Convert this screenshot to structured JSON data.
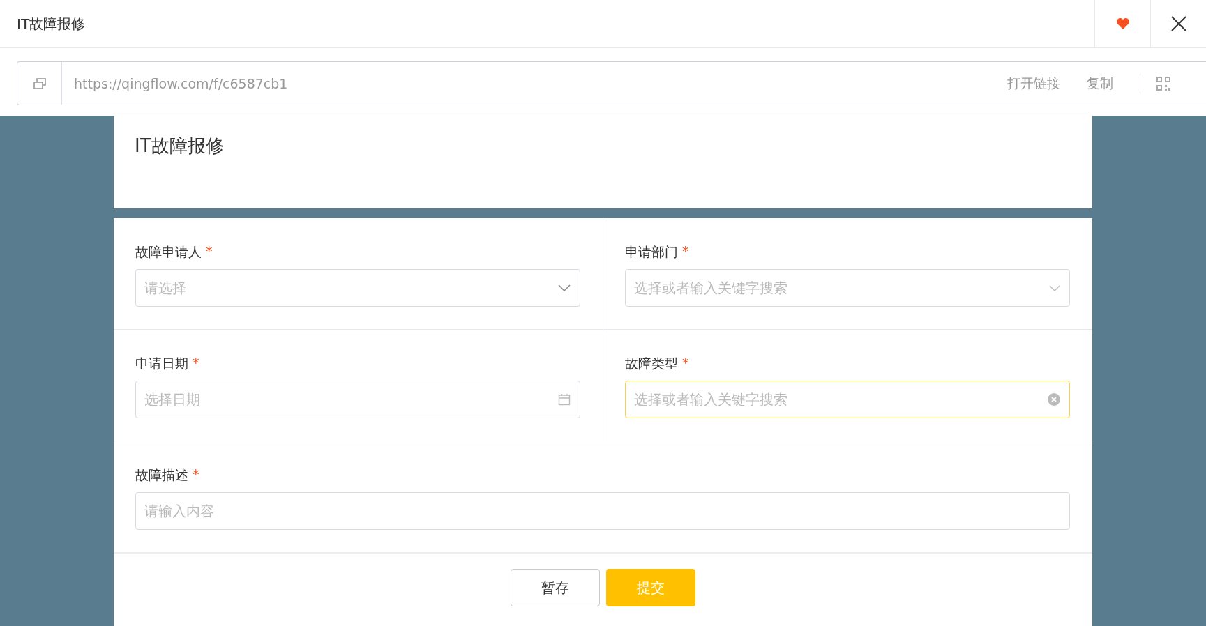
{
  "window": {
    "title": "IT故障报修",
    "favorite": true
  },
  "link_bar": {
    "url": "https://qingflow.com/f/c6587cb1",
    "actions": [
      "打开链接",
      "复制"
    ]
  },
  "form": {
    "title": "IT故障报修",
    "rows": [
      [
        {
          "label": "故障申请人",
          "required": true,
          "kind": "select",
          "placeholder": "请选择",
          "focused": false
        },
        {
          "label": "申请部门",
          "required": true,
          "kind": "search",
          "placeholder": "选择或者输入关键字搜索",
          "focused": false
        }
      ],
      [
        {
          "label": "申请日期",
          "required": true,
          "kind": "date",
          "placeholder": "选择日期",
          "focused": false
        },
        {
          "label": "故障类型",
          "required": true,
          "kind": "search",
          "placeholder": "选择或者输入关键字搜索",
          "focused": true
        }
      ],
      [
        {
          "label": "故障描述",
          "required": true,
          "kind": "text",
          "placeholder": "请输入内容",
          "focused": false
        }
      ]
    ],
    "required_mark": "*",
    "buttons": [
      {
        "label": "暂存",
        "kind": "secondary"
      },
      {
        "label": "提交",
        "kind": "primary"
      }
    ]
  }
}
